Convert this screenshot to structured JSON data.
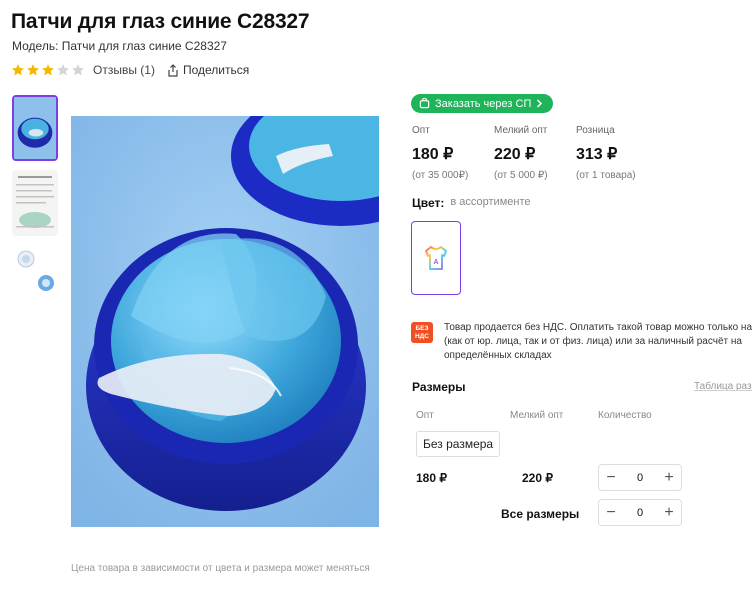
{
  "product": {
    "title": "Патчи для глаз синие C28327",
    "model": "Модель: Патчи для глаз синие C28327",
    "rating": 3,
    "rating_max": 5,
    "reviews": "Отзывы (1)",
    "share": "Поделиться"
  },
  "gallery": {
    "caption": "Цена товара в зависимости от цвета и размера может меняться"
  },
  "order_button": "Заказать через СП",
  "prices": [
    {
      "label": "Опт",
      "value": "180 ₽",
      "note": "(от 35 000₽)"
    },
    {
      "label": "Мелкий опт",
      "value": "220 ₽",
      "note": "(от 5 000 ₽)"
    },
    {
      "label": "Розница",
      "value": "313 ₽",
      "note": "(от 1 товара)"
    }
  ],
  "color": {
    "label": "Цвет:",
    "value": "в ассортименте"
  },
  "vat": {
    "badge": "БЕЗ НДС",
    "text": "Товар продается без НДС. Оплатить такой товар можно только на (как от юр. лица, так и от физ. лица) или за наличный расчёт на определённых складах"
  },
  "sizes": {
    "title": "Размеры",
    "table_link": "Таблица разм",
    "headers": {
      "opt": "Опт",
      "small_opt": "Мелкий опт",
      "qty": "Количество"
    },
    "chip": "Без размера",
    "row": {
      "opt": "180 ₽",
      "small_opt": "220 ₽",
      "qty": "0"
    },
    "all_label": "Все размеры",
    "all_qty": "0"
  },
  "colors": {
    "accent": "#7b3fe4",
    "green": "#1fb35a",
    "star": "#f5b800",
    "star_empty": "#d5d5d5",
    "vat": "#f04e23"
  }
}
